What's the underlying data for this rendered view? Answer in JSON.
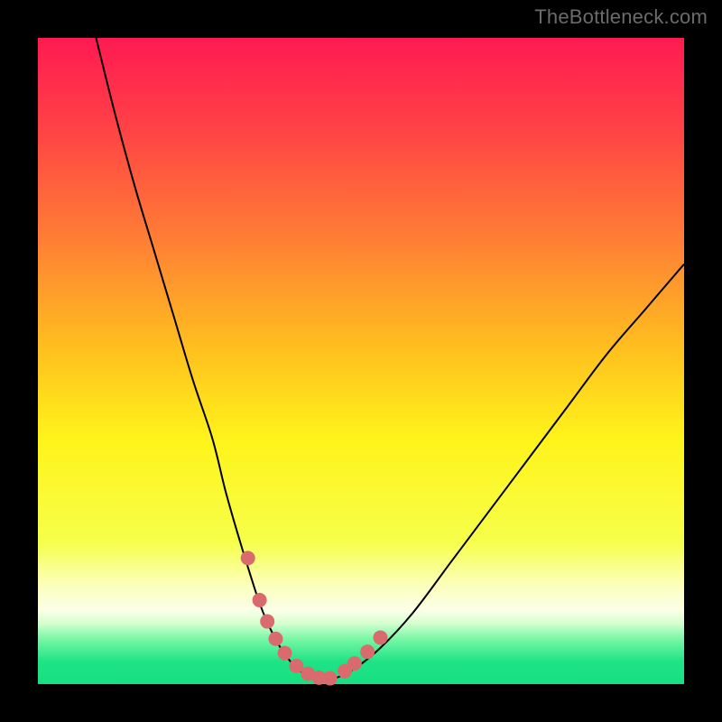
{
  "watermark": "TheBottleneck.com",
  "colors": {
    "frame": "#000000",
    "curve_stroke": "#000000",
    "marker_fill": "#d96b6f",
    "gradient_stops": [
      {
        "offset": 0.0,
        "color": "#ff1a52"
      },
      {
        "offset": 0.14,
        "color": "#ff4245"
      },
      {
        "offset": 0.3,
        "color": "#ff7a36"
      },
      {
        "offset": 0.48,
        "color": "#ffbf1f"
      },
      {
        "offset": 0.62,
        "color": "#fff31a"
      },
      {
        "offset": 0.78,
        "color": "#f6ff4a"
      },
      {
        "offset": 0.84,
        "color": "#fbffb0"
      },
      {
        "offset": 0.885,
        "color": "#fcffe8"
      },
      {
        "offset": 0.905,
        "color": "#d8ffd0"
      },
      {
        "offset": 0.93,
        "color": "#79f7a6"
      },
      {
        "offset": 0.965,
        "color": "#1fe386"
      },
      {
        "offset": 1.0,
        "color": "#17e082"
      }
    ]
  },
  "chart_data": {
    "type": "line",
    "title": "",
    "xlabel": "",
    "ylabel": "",
    "xlim": [
      0,
      100
    ],
    "ylim": [
      0,
      100
    ],
    "grid": false,
    "series": [
      {
        "name": "bottleneck-curve",
        "x": [
          9,
          12,
          15,
          18,
          21,
          24,
          27,
          29,
          31,
          33,
          34.5,
          36,
          37.5,
          39,
          40.5,
          42,
          44,
          46,
          49,
          53,
          58,
          64,
          70,
          76,
          82,
          88,
          94,
          100
        ],
        "y": [
          100,
          88,
          77,
          67,
          57,
          47,
          38,
          30,
          23,
          16.5,
          12,
          8.5,
          5.7,
          3.6,
          2.1,
          1.2,
          0.6,
          0.9,
          2.4,
          5.6,
          11,
          19,
          27,
          35,
          43,
          51,
          58,
          65
        ]
      }
    ],
    "markers": {
      "name": "highlight-points",
      "x": [
        32.5,
        34.3,
        35.5,
        36.8,
        38.2,
        40.0,
        41.8,
        43.5,
        45.2,
        47.5,
        49.0,
        51.0,
        53.0
      ],
      "y": [
        19.5,
        13.0,
        9.7,
        7.0,
        4.8,
        2.8,
        1.6,
        1.0,
        0.9,
        2.0,
        3.2,
        5.0,
        7.2
      ]
    }
  }
}
